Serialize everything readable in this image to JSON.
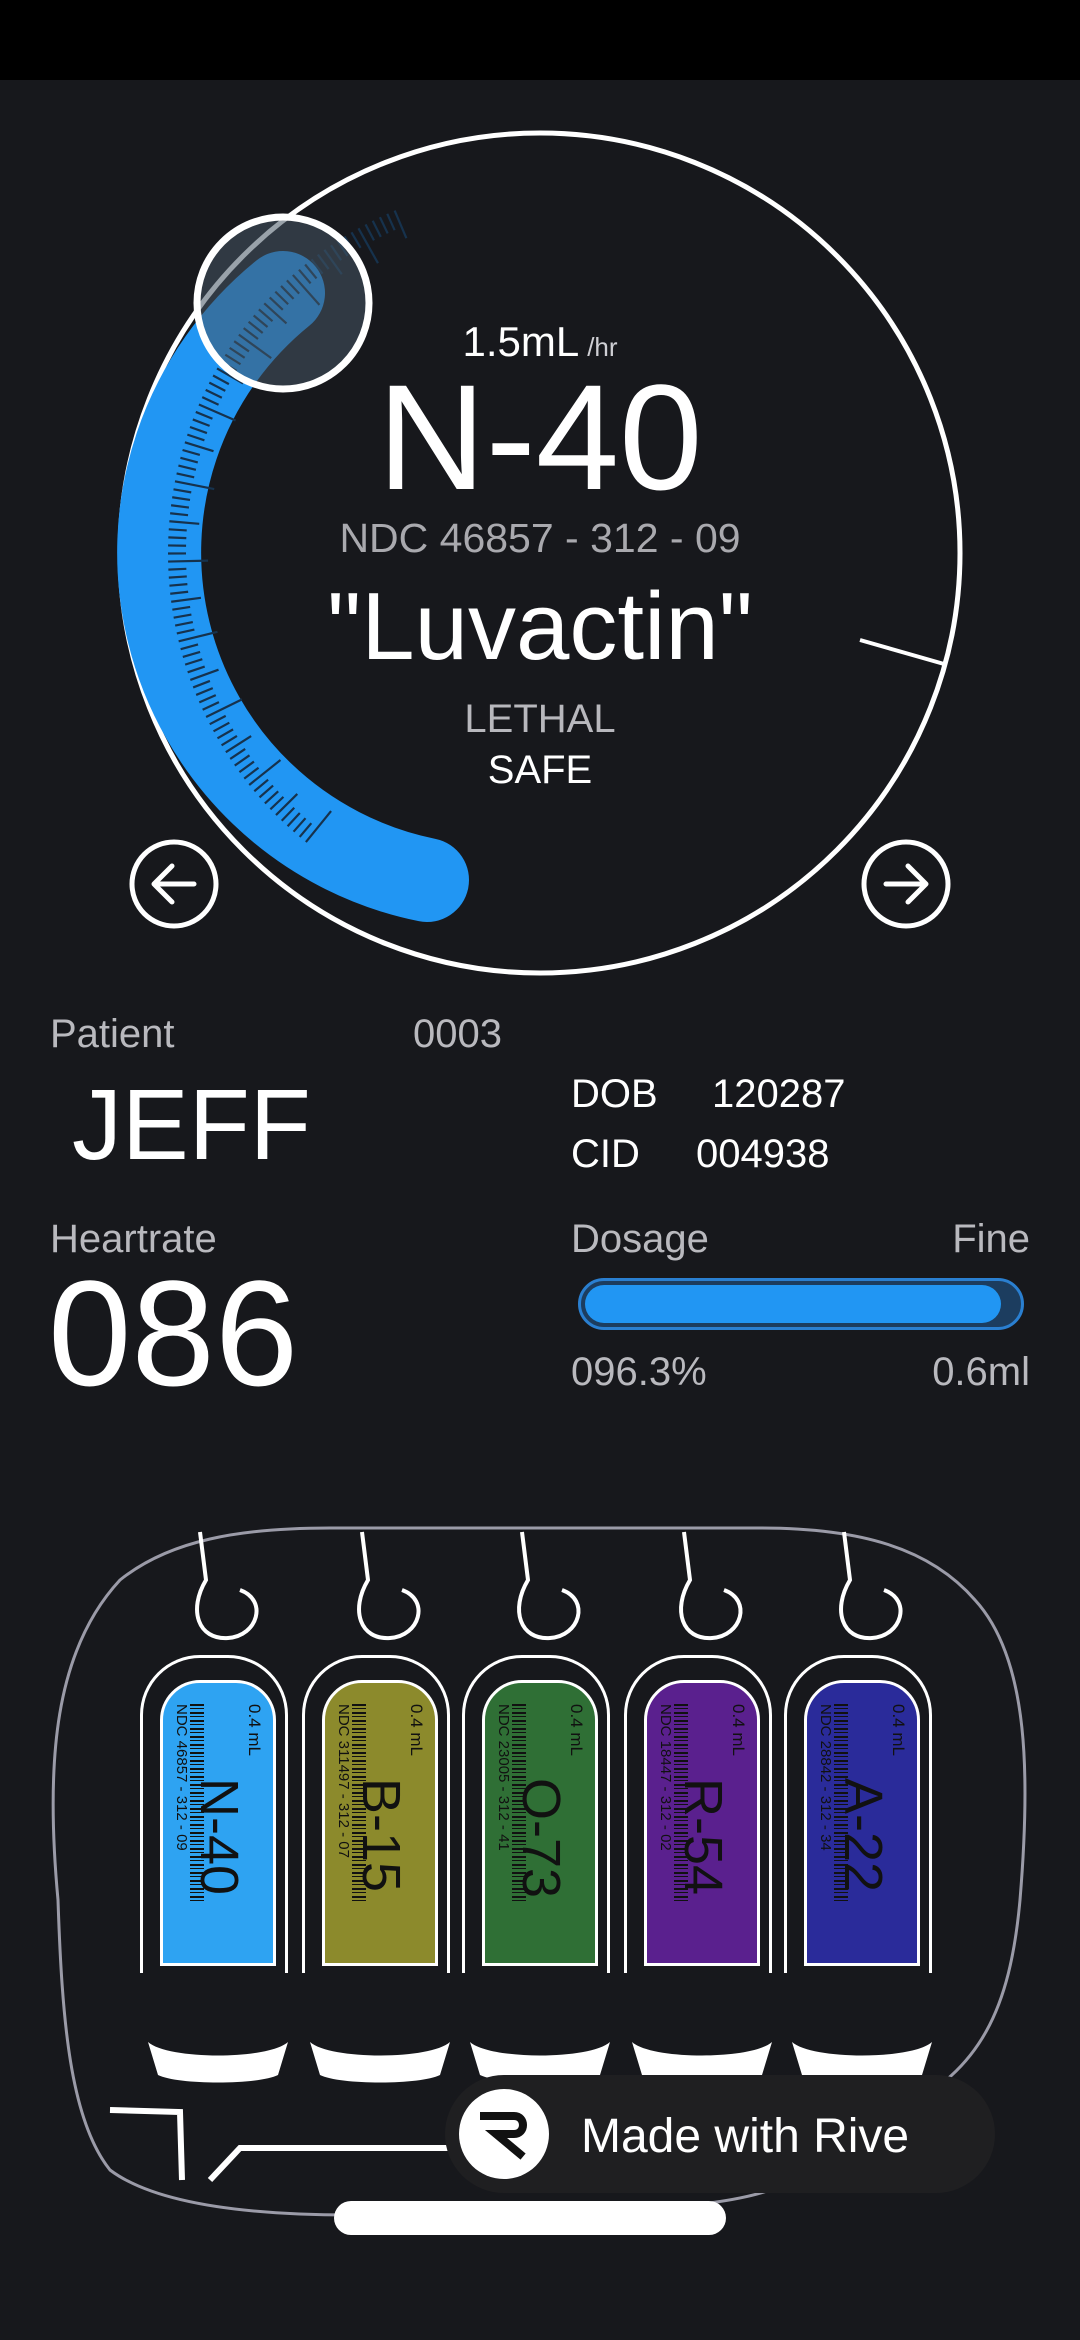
{
  "dial": {
    "rate": "1.5mL",
    "rate_unit": "/hr",
    "drug_code": "N-40",
    "ndc": "NDC 46857 - 312 - 09",
    "drug_name": "\"Luvactin\"",
    "lethal_label": "LETHAL",
    "safe_label": "SAFE",
    "prev_icon": "arrow-left-circle-icon",
    "next_icon": "arrow-right-circle-icon",
    "accent_color": "#2196f3"
  },
  "patient": {
    "label": "Patient",
    "id": "0003",
    "name": "JEFF",
    "dob_label": "DOB",
    "dob": "120287",
    "cid_label": "CID",
    "cid": "004938"
  },
  "heartrate": {
    "label": "Heartrate",
    "value": "086"
  },
  "dosage": {
    "label": "Dosage",
    "level_label": "Fine",
    "percent_text": "096.3%",
    "volume_text": "0.6ml",
    "fill_fraction": 0.963
  },
  "vials": [
    {
      "code": "N-40",
      "ndc": "NDC 46857 - 312 - 09",
      "volume": "0.4 mL",
      "color": "#2ea3f2"
    },
    {
      "code": "B-15",
      "ndc": "NDC 311497 - 312 - 07",
      "volume": "0.4 mL",
      "color": "#8c8a2c"
    },
    {
      "code": "O-73",
      "ndc": "NDC 23005 - 312 - 41",
      "volume": "0.4 mL",
      "color": "#2f6f35"
    },
    {
      "code": "R-54",
      "ndc": "NDC 18447 - 312 - 02",
      "volume": "0.4 mL",
      "color": "#5a208e"
    },
    {
      "code": "A-22",
      "ndc": "NDC 28842 - 312 - 34",
      "volume": "0.4 mL",
      "color": "#2a2b9a"
    }
  ],
  "badge": {
    "text": "Made with Rive",
    "logo": "rive-logo-icon"
  }
}
